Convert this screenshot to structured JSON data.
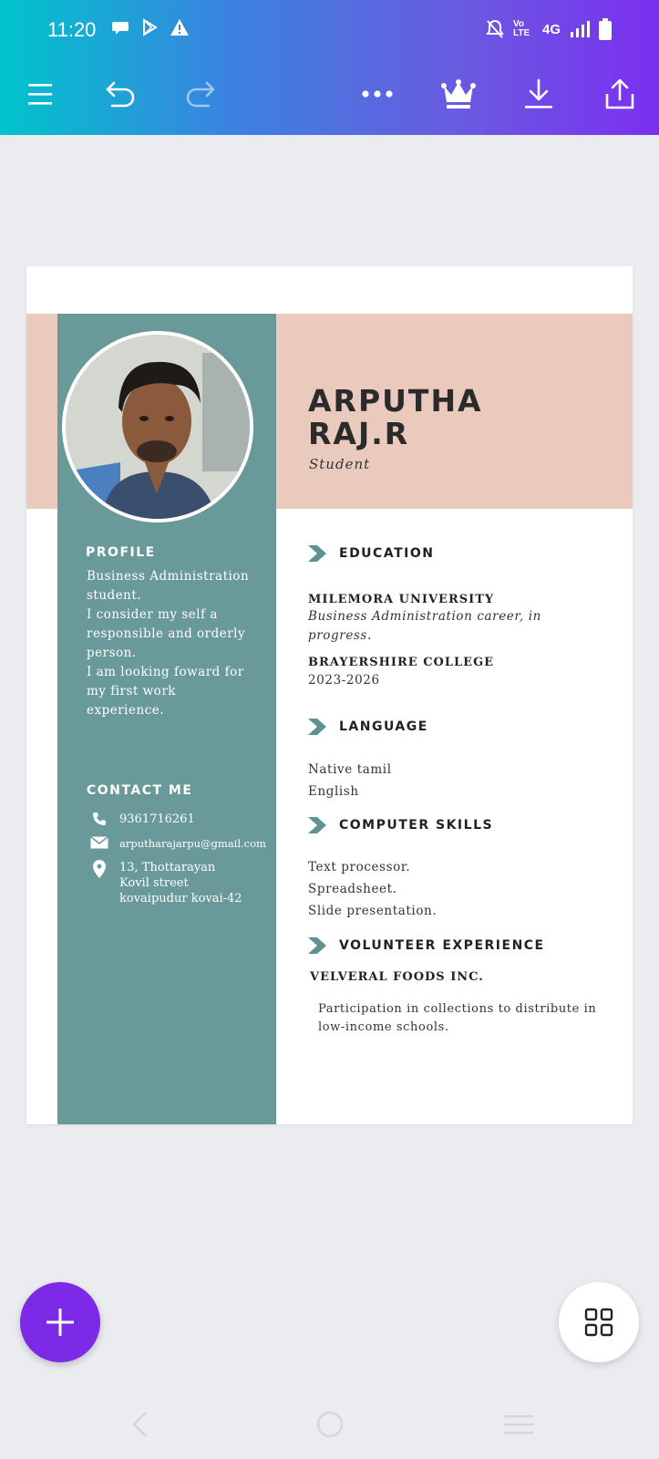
{
  "status_bar": {
    "time": "11:20",
    "network": "4G",
    "volte": "Vo LTE",
    "icons": [
      "chat-icon",
      "play-store-icon",
      "warning-icon",
      "bell-off-icon",
      "signal-icon",
      "battery-icon"
    ]
  },
  "toolbar": {
    "buttons": [
      "menu-icon",
      "undo-icon",
      "redo-icon",
      "more-icon",
      "crown-icon",
      "download-icon",
      "share-icon"
    ]
  },
  "resume": {
    "name_line1": "ARPUTHA",
    "name_line2": "RAJ.R",
    "role": "Student",
    "profile": {
      "heading": "PROFILE",
      "lines": [
        "Business Administration",
        "student.",
        "I consider my self a",
        "responsible and orderly",
        "person.",
        "I am looking foward for",
        "my first work",
        "experience."
      ]
    },
    "contact": {
      "heading": "CONTACT ME",
      "phone": "9361716261",
      "email": "arputharajarpu@gmail.com",
      "address_line1": "13, Thottarayan",
      "address_line2": "Kovil street",
      "address_line3": "kovaipudur kovai-42"
    },
    "education": {
      "heading": "EDUCATION",
      "school1": "MILEMORA UNIVERSITY",
      "school1_desc_line1": "Business Administration career, in",
      "school1_desc_line2": "progress.",
      "school2": "BRAYERSHIRE COLLEGE",
      "school2_years": "2023-2026"
    },
    "language": {
      "heading": "LANGUAGE",
      "items": [
        "Native tamil",
        "English"
      ]
    },
    "computer_skills": {
      "heading": "COMPUTER SKILLS",
      "items": [
        "Text processor.",
        "Spreadsheet.",
        "Slide presentation."
      ]
    },
    "volunteer": {
      "heading": "VOLUNTEER EXPERIENCE",
      "org": "VELVERAL FOODS INC.",
      "desc_line1": "Participation in collections to distribute in",
      "desc_line2": "low-income schools."
    }
  },
  "colors": {
    "teal": "#6a9999",
    "pink": "#ebcabe",
    "fab_purple": "#7d2ae8"
  }
}
